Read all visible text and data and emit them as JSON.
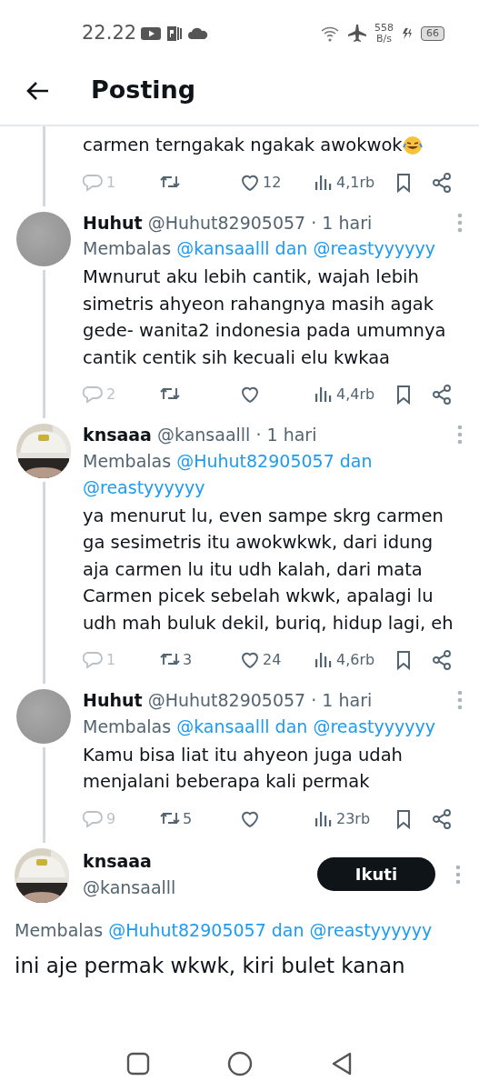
{
  "status_bar": {
    "time": "22.22",
    "net_speed": "558",
    "net_unit": "B/s",
    "battery": "66"
  },
  "header": {
    "title": "Posting"
  },
  "thread_tail": {
    "text": "carmen terngakak ngakak awokwok",
    "stats": {
      "replies": "1",
      "likes": "12",
      "views": "4,1rb"
    }
  },
  "replies": [
    {
      "avatar": {
        "kind": "gray"
      },
      "name": "Huhut",
      "handle": "@Huhut82905057",
      "time": "· 1 hari",
      "reply_prefix": "Membalas",
      "reply_to": {
        "first": "@kansaalll",
        "joiner": "dan",
        "second": "@reastyyyyyy"
      },
      "text": "Mwnurut aku lebih cantik, wajah lebih simetris ahyeon rahangnya masih agak gede- wanita2 indonesia pada umumnya cantik centik sih kecuali elu kwkaa",
      "stats": {
        "replies": "2",
        "views": "4,4rb"
      }
    },
    {
      "name": "knsaaa",
      "handle": "@kansaalll",
      "time": "· 1 hari",
      "reply_prefix": "Membalas",
      "reply_to": {
        "first": "@Huhut82905057",
        "joiner": "dan",
        "second": "@reastyyyyyy"
      },
      "text": "ya menurut lu, even sampe skrg carmen ga sesimetris itu awokwkwk, dari idung aja carmen lu itu udh kalah, dari mata Carmen picek sebelah wkwk, apalagi lu udh mah buluk dekil, buriq, hidup lagi, eh",
      "stats": {
        "replies": "1",
        "retweets": "3",
        "likes": "24",
        "views": "4,6rb"
      }
    },
    {
      "avatar": {
        "kind": "gray"
      },
      "name": "Huhut",
      "handle": "@Huhut82905057",
      "time": "· 1 hari",
      "reply_prefix": "Membalas",
      "reply_to": {
        "first": "@kansaalll",
        "joiner": "dan",
        "second": "@reastyyyyyy"
      },
      "text": "Kamu bisa liat itu ahyeon juga udah menjalani beberapa kali permak",
      "stats": {
        "replies": "9",
        "retweets": "5",
        "views": "23rb"
      }
    }
  ],
  "main_tweet": {
    "name": "knsaaa",
    "handle": "@kansaalll",
    "follow_button": "Ikuti",
    "reply_prefix": "Membalas",
    "reply_to": {
      "first": "@Huhut82905057",
      "joiner": "dan",
      "second": "@reastyyyyyy"
    },
    "text": "ini aje permak wkwk, kiri bulet kanan"
  }
}
